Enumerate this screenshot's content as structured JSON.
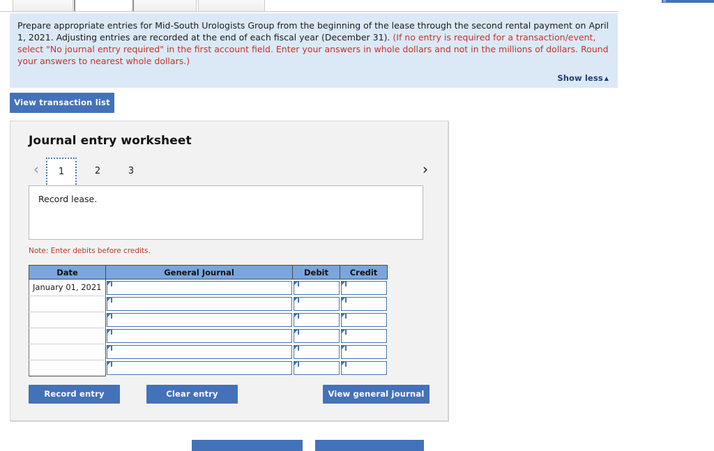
{
  "window": {
    "top_tabs": [
      "",
      "",
      ""
    ],
    "topright_action_label": ""
  },
  "instructions": {
    "text_plain_1": "Prepare appropriate entries for Mid-South Urologists Group from the beginning of the lease through the second rental payment on April 1, 2021. Adjusting entries are recorded at the end of each fiscal year (December 31). ",
    "text_required_note": "(If no entry is required for a transaction/event, select \"No journal entry required\" in the first account field. Enter your answers in whole dollars and not in the millions of dollars. Round your answers to nearest whole dollars.)",
    "show_less_label": "Show less",
    "show_less_caret": "▲",
    "panel_bg": "#dbe9f6",
    "required_text_color": "#c2342b"
  },
  "toolbar": {
    "view_transaction_list_label": "View transaction list"
  },
  "worksheet": {
    "title": "Journal entry worksheet",
    "pager": {
      "prev_icon": "‹",
      "next_icon": "›",
      "pages": [
        "1",
        "2",
        "3"
      ],
      "active_page": "1"
    },
    "entry_description": "Record lease.",
    "debit_note": "Note: Enter debits before credits.",
    "table": {
      "headers": [
        "Date",
        "General Journal",
        "Debit",
        "Credit"
      ],
      "rows": [
        {
          "date": "January 01, 2021",
          "general_journal": "",
          "debit": "",
          "credit": ""
        },
        {
          "date": "",
          "general_journal": "",
          "debit": "",
          "credit": ""
        },
        {
          "date": "",
          "general_journal": "",
          "debit": "",
          "credit": ""
        },
        {
          "date": "",
          "general_journal": "",
          "debit": "",
          "credit": ""
        },
        {
          "date": "",
          "general_journal": "",
          "debit": "",
          "credit": ""
        },
        {
          "date": "",
          "general_journal": "",
          "debit": "",
          "credit": ""
        }
      ]
    },
    "actions": {
      "record_entry_label": "Record entry",
      "clear_entry_label": "Clear entry",
      "view_general_journal_label": "View general journal"
    }
  },
  "footer": {
    "left_button_label": "",
    "right_button_label": ""
  },
  "colors": {
    "button_blue": "#4472b8",
    "table_header_blue": "#7aa6dd",
    "input_border_blue": "#4670ad",
    "card_bg": "#f2f2f2",
    "link_navy": "#1f3d70"
  }
}
